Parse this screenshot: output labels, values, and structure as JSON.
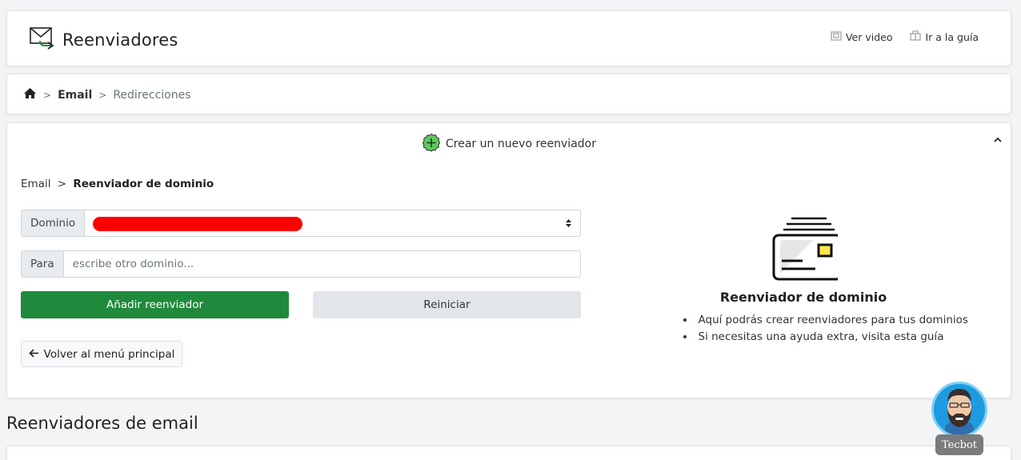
{
  "header": {
    "title": "Reenviadores",
    "video_link": "Ver video",
    "guide_link": "Ir a la guía"
  },
  "breadcrumb": {
    "email": "Email",
    "current": "Redirecciones",
    "separator": ">"
  },
  "panel": {
    "heading": "Crear un nuevo reenviador",
    "sub_crumb_first": "Email",
    "sub_crumb_sep": ">",
    "sub_crumb_current": "Reenviador de dominio",
    "dominio_label": "Dominio",
    "para_label": "Para",
    "para_placeholder": "escribe otro dominio...",
    "add_button": "Añadir reenviador",
    "reset_button": "Reiniciar",
    "back_button": "Volver al menú principal",
    "info_title": "Reenviador de dominio",
    "info_items": [
      "Aquí podrás crear reenviadores para tus dominios",
      "Si necesitas una ayuda extra, visita esta guía"
    ]
  },
  "section_title": "Reenviadores de email",
  "tecbot": {
    "label": "Tecbot"
  },
  "colors": {
    "primary_green": "#1f8a3c",
    "redaction": "#ff0000",
    "tecbot_blue": "#1e9be0"
  },
  "icons": {
    "header": "mail-forward-icon",
    "video": "video-icon",
    "guide": "guide-icon",
    "home": "home-icon",
    "add": "plus-circle-icon",
    "collapse": "chevron-up-icon",
    "back": "arrow-left-icon",
    "info": "mail-card-icon"
  }
}
